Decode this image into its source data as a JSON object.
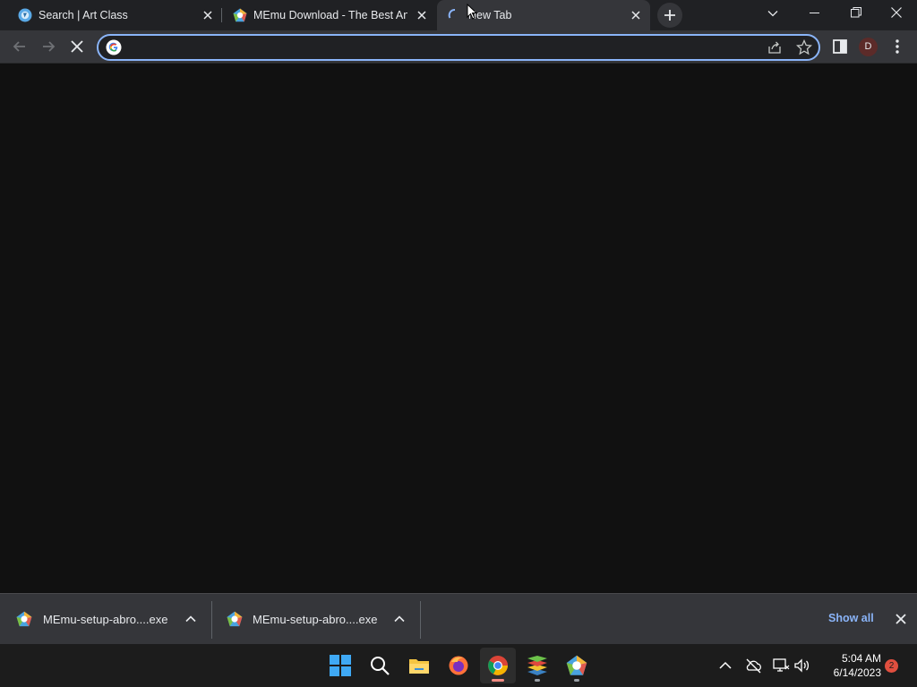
{
  "tabs": [
    {
      "title": "Search | Art Class",
      "favicon": "art-class-icon",
      "active": false
    },
    {
      "title": "MEmu Download - The Best Android",
      "favicon": "memu-icon",
      "active": false
    },
    {
      "title": "New Tab",
      "favicon": "loading-spinner-icon",
      "active": true
    }
  ],
  "toolbar": {
    "address_value": "",
    "profile_initial": "D"
  },
  "downloads": [
    {
      "filename": "MEmu-setup-abro....exe",
      "icon": "memu-icon"
    },
    {
      "filename": "MEmu-setup-abro....exe",
      "icon": "memu-icon"
    }
  ],
  "download_shelf": {
    "show_all_label": "Show all"
  },
  "taskbar": {
    "apps": [
      "windows-start-icon",
      "search-icon",
      "file-explorer-icon",
      "firefox-icon",
      "chrome-icon",
      "bluestacks-icon",
      "memu-icon"
    ],
    "time": "5:04 AM",
    "date": "6/14/2023",
    "notification_count": "2"
  },
  "colors": {
    "accent": "#8ab4f8",
    "tab_bar": "#202124",
    "toolbar": "#35363a",
    "page_bg": "#111111",
    "taskbar": "#1c1c1c"
  }
}
